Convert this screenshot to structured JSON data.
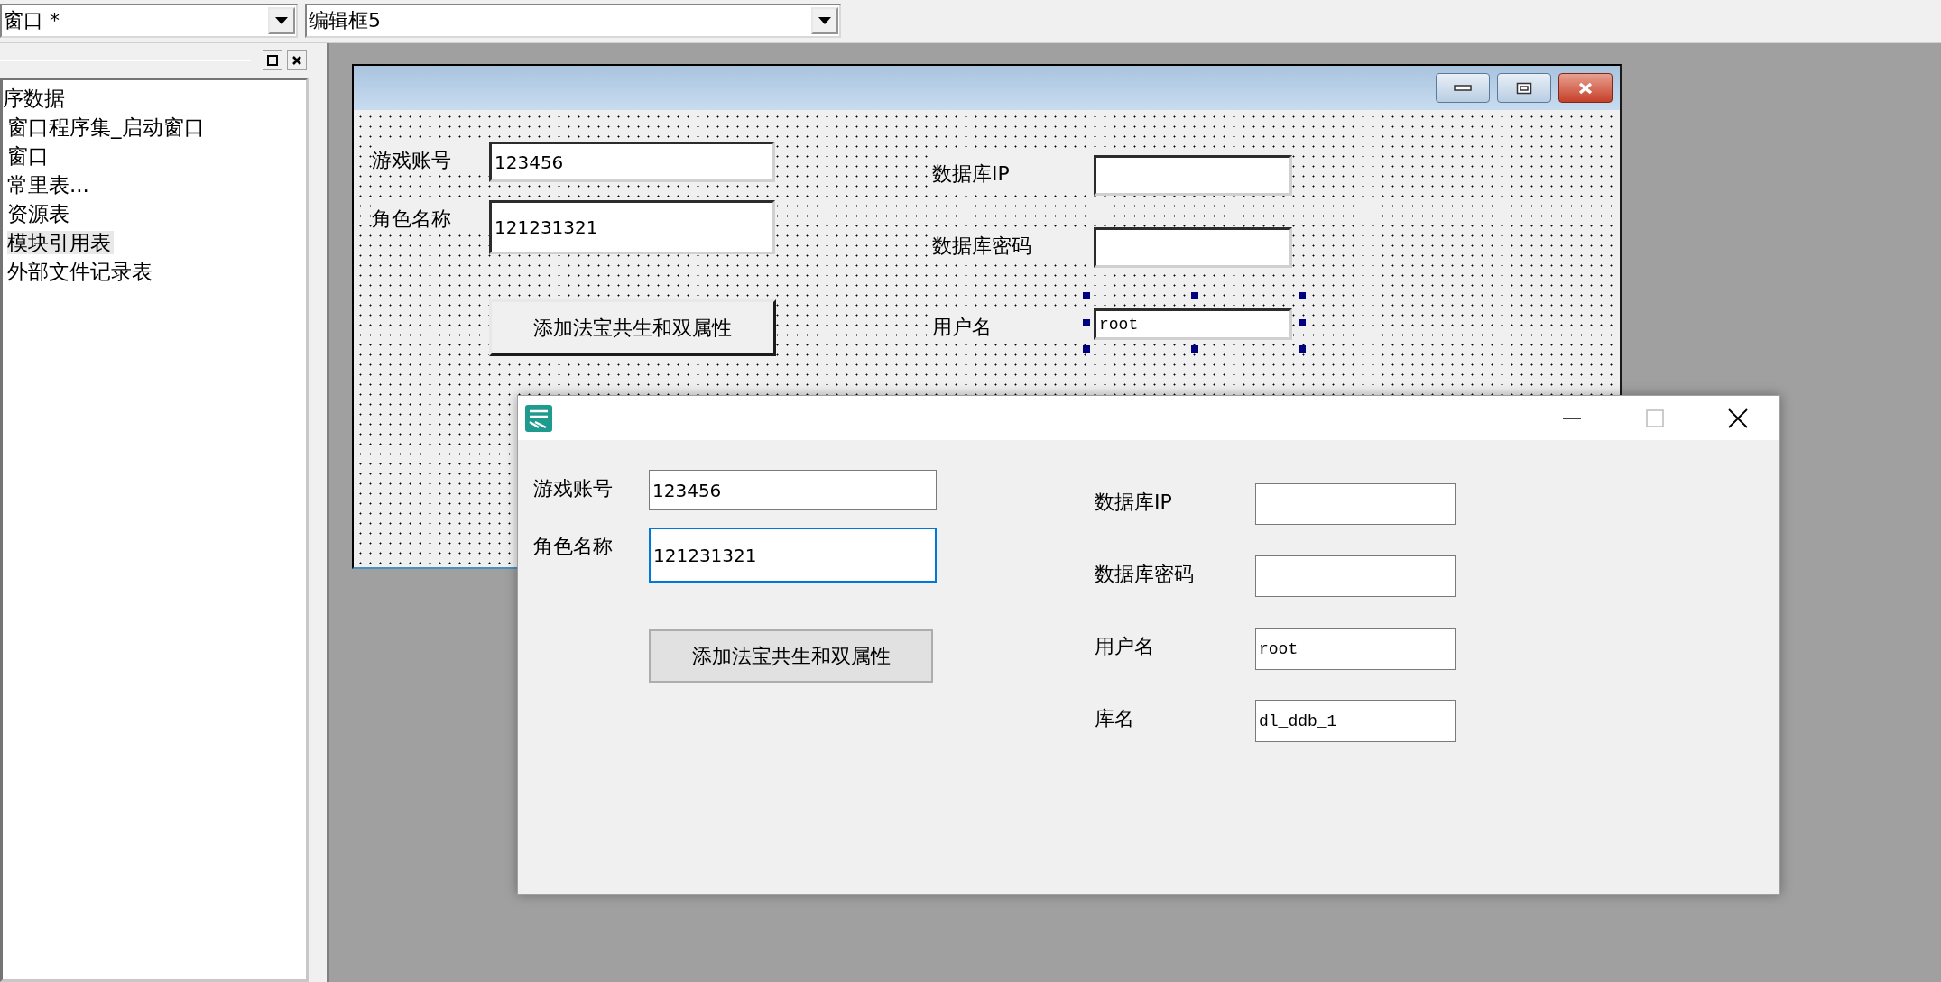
{
  "toolbar": {
    "window_selector": "窗口 *",
    "control_selector": "编辑框5"
  },
  "project_tree": {
    "root": "序数据",
    "items": [
      {
        "label": "窗口程序集_启动窗口",
        "selected": false
      },
      {
        "label": "窗口",
        "selected": false
      },
      {
        "label": "常里表...",
        "selected": false
      },
      {
        "label": "资源表",
        "selected": false
      },
      {
        "label": "模块引用表",
        "selected": true
      },
      {
        "label": "外部文件记录表",
        "selected": false
      }
    ]
  },
  "design_window": {
    "left_fields": [
      {
        "label": "游戏账号",
        "value": "123456"
      },
      {
        "label": "角色名称",
        "value": "121231321"
      }
    ],
    "button": "添加法宝共生和双属性",
    "right_fields": [
      {
        "label": "数据库IP",
        "selected": false
      },
      {
        "label": "数据库密码",
        "selected": false
      },
      {
        "label": "用户名",
        "value": "root",
        "selected": true
      }
    ]
  },
  "running_window": {
    "left_fields": [
      {
        "label": "游戏账号",
        "value": "123456",
        "focused": false
      },
      {
        "label": "角色名称",
        "value": "121231321",
        "focused": true
      }
    ],
    "button": "添加法宝共生和双属性",
    "right_fields": [
      {
        "label": "数据库IP"
      },
      {
        "label": "数据库密码"
      },
      {
        "label": "用户名",
        "value": "root"
      },
      {
        "label": "库名",
        "value": "dl_ddb_1"
      }
    ]
  }
}
